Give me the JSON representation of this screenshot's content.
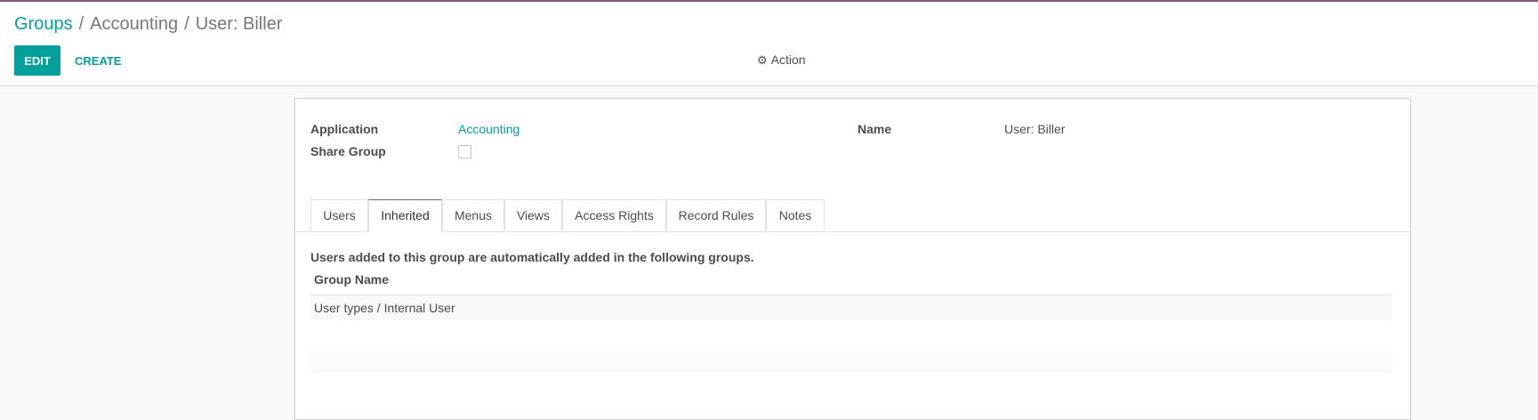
{
  "breadcrumb": {
    "root": "Groups",
    "separator": "/",
    "middle": "Accounting",
    "current": "User: Biller"
  },
  "toolbar": {
    "edit_label": "EDIT",
    "create_label": "CREATE",
    "action_label": "Action",
    "action_icon": "gear-icon"
  },
  "form": {
    "application_label": "Application",
    "application_value": "Accounting",
    "share_group_label": "Share Group",
    "share_group_checked": false,
    "name_label": "Name",
    "name_value": "User: Biller"
  },
  "tabs": [
    {
      "label": "Users"
    },
    {
      "label": "Inherited",
      "active": true
    },
    {
      "label": "Menus"
    },
    {
      "label": "Views"
    },
    {
      "label": "Access Rights"
    },
    {
      "label": "Record Rules"
    },
    {
      "label": "Notes"
    }
  ],
  "inherited": {
    "note": "Users added to this group are automatically added in the following groups.",
    "column_header": "Group Name",
    "rows": [
      "User types / Internal User"
    ]
  },
  "colors": {
    "accent": "#00a09d",
    "brand": "#875a7b"
  }
}
